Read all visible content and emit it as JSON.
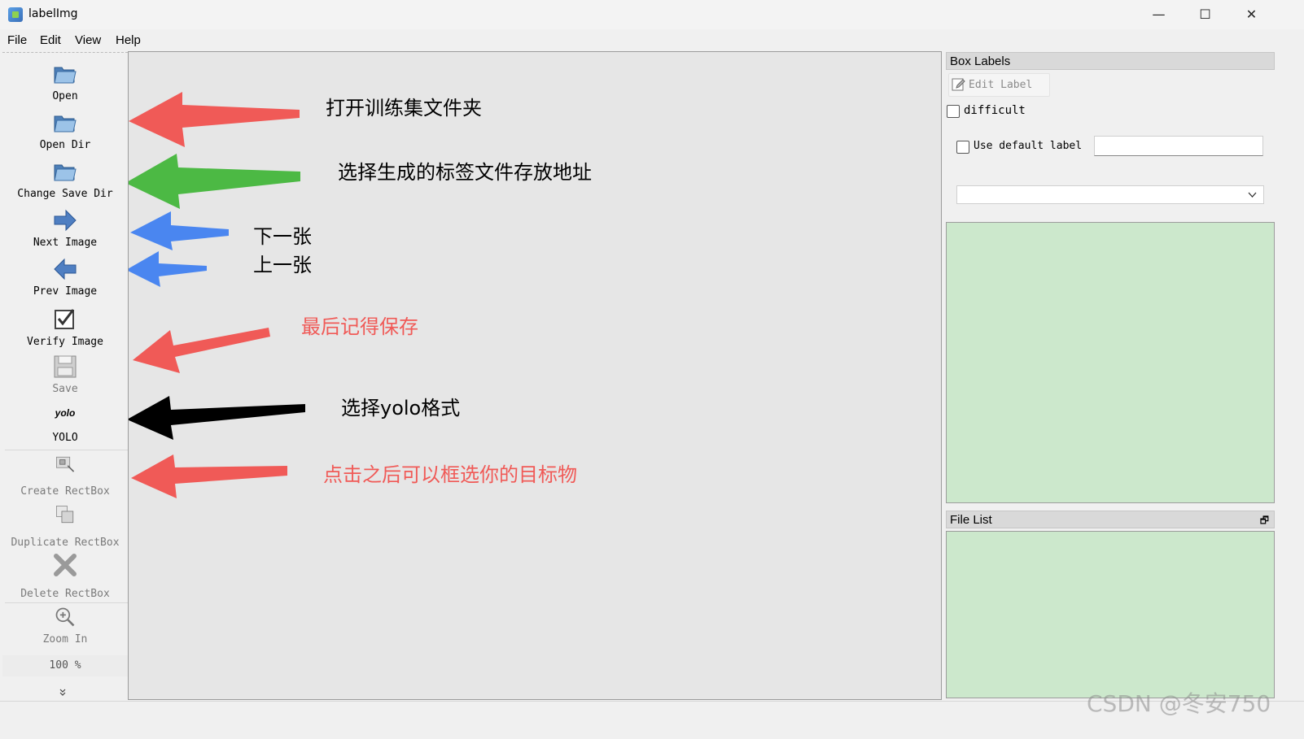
{
  "window": {
    "title": "labelImg",
    "minimize": "—",
    "maximize": "☐",
    "close": "✕"
  },
  "menu": [
    "File",
    "Edit",
    "View",
    "Help"
  ],
  "toolbar": {
    "open": "Open",
    "open_dir": "Open Dir",
    "change_save_dir": "Change Save Dir",
    "next_image": "Next Image",
    "prev_image": "Prev Image",
    "verify_image": "Verify Image",
    "save": "Save",
    "yolo_icon_text": "yolo",
    "yolo": "YOLO",
    "create_rectbox": "Create RectBox",
    "duplicate_rectbox": "Duplicate RectBox",
    "delete_rectbox": "Delete RectBox",
    "zoom_in": "Zoom In",
    "zoom_level": "100 %",
    "more": "»"
  },
  "annotations": {
    "open_dir_note": "打开训练集文件夹",
    "save_dir_note": "选择生成的标签文件存放地址",
    "next_note": "下一张",
    "prev_note": "上一张",
    "save_note": "最后记得保存",
    "yolo_note": "选择yolo格式",
    "create_note": "点击之后可以框选你的目标物"
  },
  "annotation_colors": {
    "red": "#f05a57",
    "green": "#4cb944",
    "blue": "#4a86f0",
    "black": "#000000"
  },
  "box_labels": {
    "title": "Box Labels",
    "edit_label": "Edit Label",
    "difficult": "difficult",
    "use_default_label": "Use default label",
    "default_label_value": "",
    "combo_value": ""
  },
  "file_list": {
    "title": "File List",
    "float_icon": "🗗"
  },
  "watermark": "CSDN @冬安750",
  "colors": {
    "list_bg": "#cce8cc",
    "canvas_bg": "#e6e6e6"
  }
}
